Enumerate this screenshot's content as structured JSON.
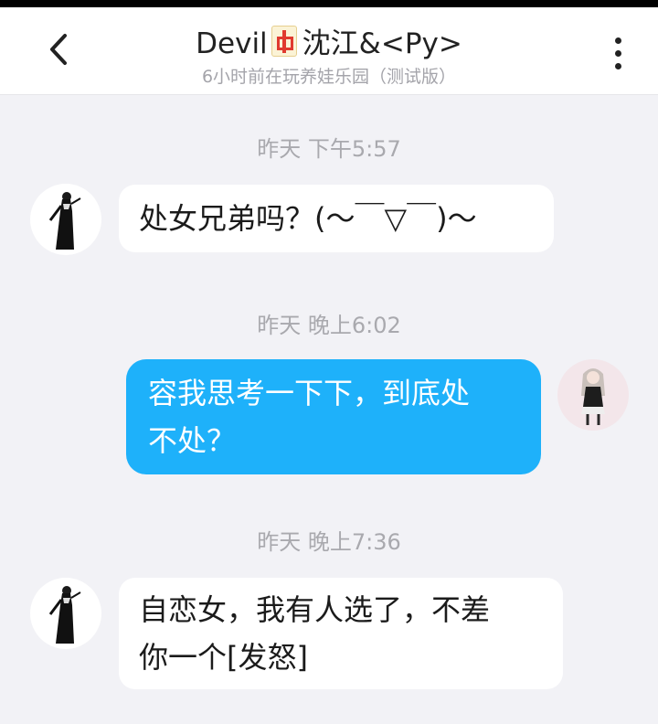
{
  "header": {
    "title_left": "Devil",
    "title_right": "沈江&<Py>",
    "subtitle": "6小时前在玩养娃乐园（测试版）",
    "back_icon": "chevron-left-icon",
    "more_icon": "more-vertical-icon",
    "emblem_icon": "mahjong-zhong-tile-icon"
  },
  "messages": [
    {
      "time": "昨天 下午5:57",
      "side": "in",
      "lines": [
        "处女兄弟吗？(～￣▽￣)～"
      ]
    },
    {
      "time": "昨天 晚上6:02",
      "side": "out",
      "lines": [
        "容我思考一下下，到底处",
        "不处？"
      ]
    },
    {
      "time": "昨天 晚上7:36",
      "side": "in",
      "lines": [
        "自恋女，我有人选了，不差",
        "你一个[发怒]"
      ]
    }
  ],
  "colors": {
    "background": "#f2f2f6",
    "outgoing_bubble": "#1eb1fa",
    "incoming_bubble": "#ffffff",
    "timestamp": "#a9a9ae"
  }
}
